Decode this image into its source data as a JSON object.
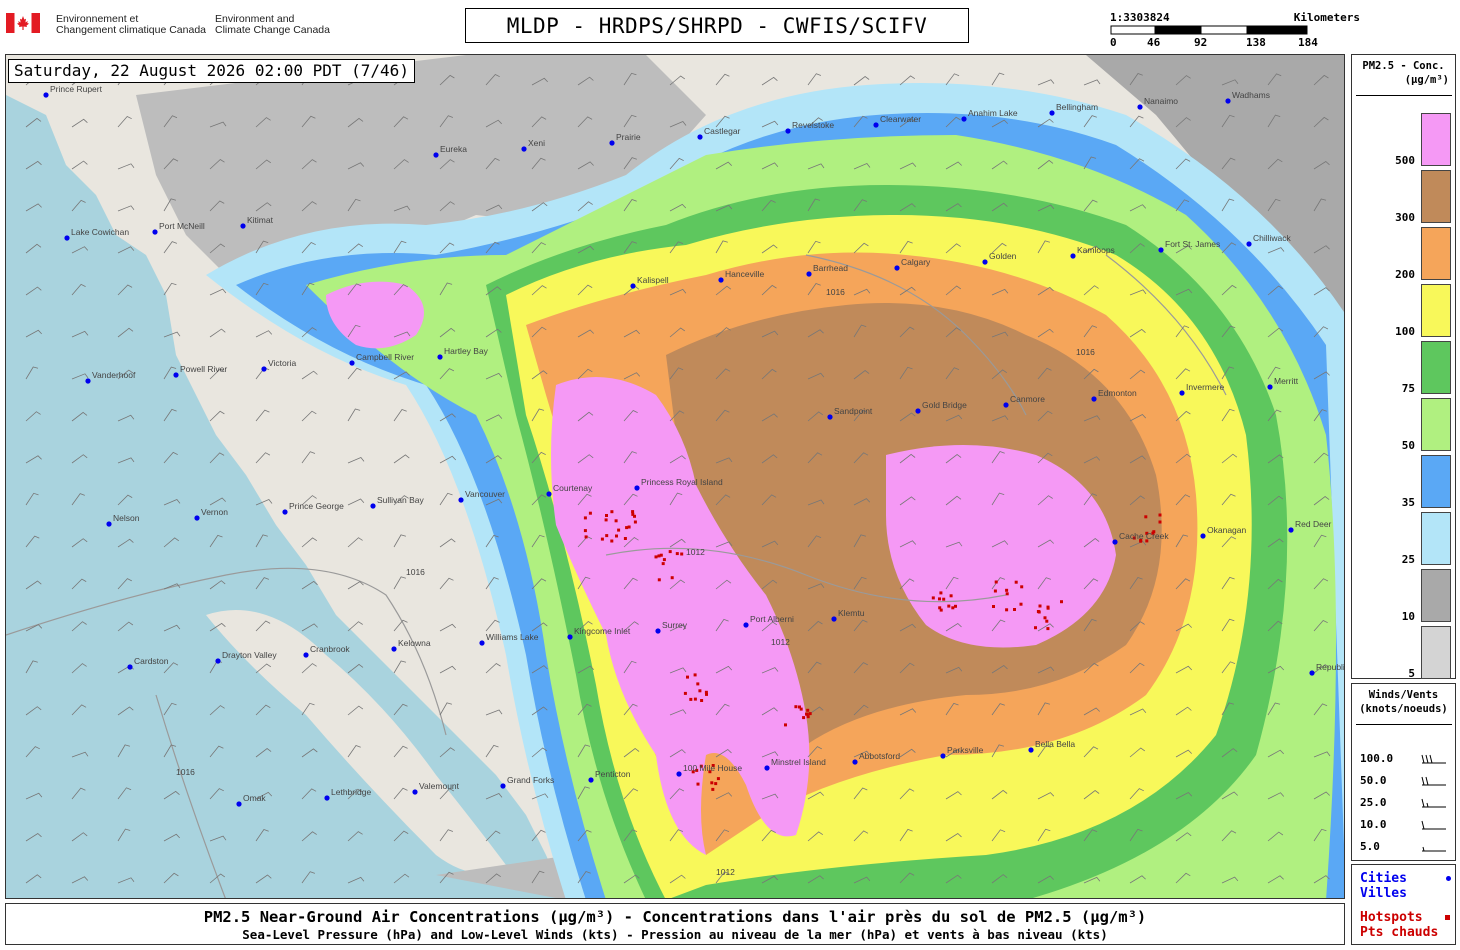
{
  "header": {
    "dept_fr": [
      "Environnement et",
      "Changement climatique Canada"
    ],
    "dept_en": [
      "Environment and",
      "Climate Change Canada"
    ],
    "title": "MLDP - HRDPS/SHRPD - CWFIS/SCIFV"
  },
  "scale_bar": {
    "ratio": "1:3303824",
    "unit": "Kilometers",
    "ticks": [
      "0",
      "46",
      "92",
      "138",
      "184"
    ]
  },
  "timestamp": "Saturday, 22 August 2026 02:00 PDT (7/46)",
  "legend_pm": {
    "title_line1": "PM2.5 - Conc.",
    "title_line2": "(µg/m³)",
    "levels": [
      {
        "label": "500",
        "color": "#f599f5"
      },
      {
        "label": "300",
        "color": "#c08a5a"
      },
      {
        "label": "200",
        "color": "#f5a55a"
      },
      {
        "label": "100",
        "color": "#f8f85a"
      },
      {
        "label": "75",
        "color": "#5ec75e"
      },
      {
        "label": "50",
        "color": "#b0f080"
      },
      {
        "label": "35",
        "color": "#5aa8f5"
      },
      {
        "label": "25",
        "color": "#b3e5f8"
      },
      {
        "label": "10",
        "color": "#a9a9a9"
      },
      {
        "label": "5",
        "color": "#d4d4d4"
      }
    ]
  },
  "legend_wind": {
    "title_line1": "Winds/Vents",
    "title_line2": "(knots/noeuds)",
    "rows": [
      "100.0",
      "50.0",
      "25.0",
      "10.0",
      "5.0"
    ]
  },
  "legend_points": {
    "cities_en": "Cities",
    "cities_fr": "Villes",
    "hotspots_en": "Hotspots",
    "hotspots_fr": "Pts chauds",
    "city_color": "#0000ee",
    "hotspot_color": "#cc0000"
  },
  "caption": {
    "line1": "PM2.5 Near-Ground Air Concentrations (µg/m³) - Concentrations dans l'air près du sol de PM2.5 (µg/m³)",
    "line2": "Sea-Level Pressure (hPa) and Low-Level Winds (kts) - Pression au niveau de la mer (hPa) et vents à bas niveau (kts)"
  },
  "map": {
    "isobars": [
      "1016",
      "1012",
      "1016",
      "1016",
      "1012",
      "1016",
      "1012"
    ],
    "cities": [
      "Prince Rupert",
      "Kitimat",
      "Hartley Bay",
      "Princess Royal Island",
      "Klemtu",
      "Bella Bella",
      "Wadhams",
      "Port McNeill",
      "Campbell River",
      "Courtenay",
      "Port Alberni",
      "Parksville",
      "Nanaimo",
      "Lake Cowichan",
      "Victoria",
      "Vancouver",
      "Surrey",
      "Abbotsford",
      "Bellingham",
      "Chilliwack",
      "Powell River",
      "Sullivan Bay",
      "Kingcome Inlet",
      "Minstrel Island",
      "Anahim Lake",
      "Fort St. James",
      "Vanderhoof",
      "Prince George",
      "Williams Lake",
      "100 Mile House",
      "Clearwater",
      "Kamloops",
      "Merritt",
      "Vernon",
      "Kelowna",
      "Penticton",
      "Revelstoke",
      "Golden",
      "Invermere",
      "Nelson",
      "Cranbrook",
      "Grand Forks",
      "Castlegar",
      "Calgary",
      "Edmonton",
      "Red Deer",
      "Drayton Valley",
      "Valemount",
      "Prairie",
      "Barrhead",
      "Canmore",
      "Okanagan",
      "Cardston",
      "Lethbridge",
      "Xeni",
      "Hanceville",
      "Gold Bridge",
      "Cache Creek",
      "Republic",
      "Omak",
      "Eureka",
      "Kalispell",
      "Sandpoint"
    ]
  }
}
